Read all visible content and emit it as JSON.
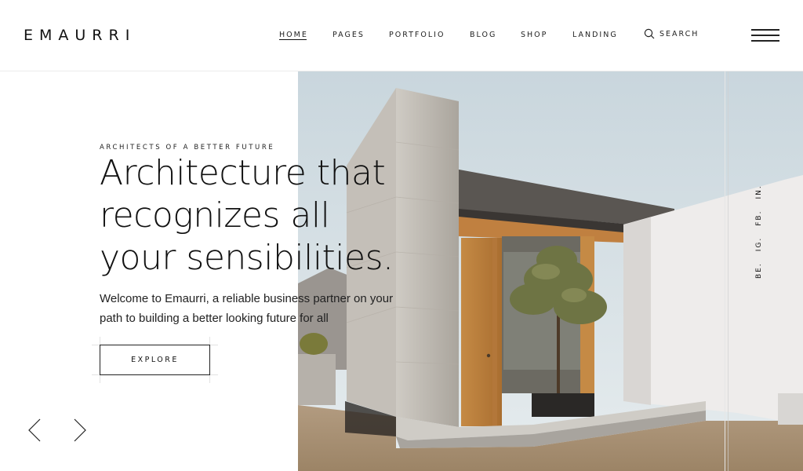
{
  "header": {
    "logo": "EMAURRI",
    "nav": [
      {
        "label": "HOME",
        "active": true
      },
      {
        "label": "PAGES"
      },
      {
        "label": "PORTFOLIO"
      },
      {
        "label": "BLOG"
      },
      {
        "label": "SHOP"
      },
      {
        "label": "LANDING"
      }
    ],
    "search_label": "SEARCH",
    "search_icon": "search-icon",
    "menu_icon": "hamburger-menu-icon"
  },
  "hero": {
    "subtitle": "ARCHITECTS OF A BETTER FUTURE",
    "headline": [
      "Architecture that",
      "recognizes all",
      "your sensibilities."
    ],
    "intro_line1": "Welcome to Emaurri, a reliable business partner on your",
    "intro_line2": "path to building a better looking future for all",
    "cta": "EXPLORE"
  },
  "slider": {
    "prev_icon": "chevron-left-icon",
    "next_icon": "chevron-right-icon"
  },
  "social": [
    "BE.",
    "IG.",
    "FB.",
    "IN."
  ],
  "colors": {
    "text": "#111111",
    "background": "#ffffff",
    "divider": "#e6e6e6"
  }
}
